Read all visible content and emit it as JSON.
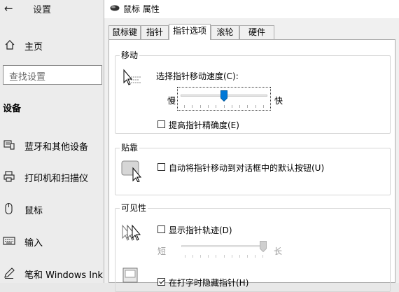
{
  "settings": {
    "back_glyph": "←",
    "title": "设置",
    "home_label": "主页",
    "search_placeholder": "查找设置",
    "section_title": "设备",
    "nav_items": [
      {
        "label": "蓝牙和其他设备",
        "icon": "bluetooth-devices-icon"
      },
      {
        "label": "打印机和扫描仪",
        "icon": "printer-icon"
      },
      {
        "label": "鼠标",
        "icon": "mouse-icon"
      },
      {
        "label": "输入",
        "icon": "keyboard-icon"
      },
      {
        "label": "笔和 Windows Ink",
        "icon": "pen-icon"
      }
    ]
  },
  "dialog": {
    "title": "鼠标 属性",
    "tabs": [
      "鼠标键",
      "指针",
      "指针选项",
      "滚轮",
      "硬件"
    ],
    "active_tab": "指针选项",
    "motion": {
      "group_label": "移动",
      "speed_label": "选择指针移动速度(C):",
      "slow_label": "慢",
      "fast_label": "快",
      "speed_fraction": 0.5,
      "precision_label": "提高指针精确度(E)",
      "precision_checked": false
    },
    "snap": {
      "group_label": "贴靠",
      "snap_label": "自动将指针移动到对话框中的默认按钮(U)",
      "snap_checked": false
    },
    "visibility": {
      "group_label": "可见性",
      "trails_label": "显示指针轨迹(D)",
      "trails_checked": false,
      "short_label": "短",
      "long_label": "长",
      "trails_fraction": 1.0,
      "hide_label": "在打字时隐藏指针(H)",
      "hide_checked": true
    }
  }
}
